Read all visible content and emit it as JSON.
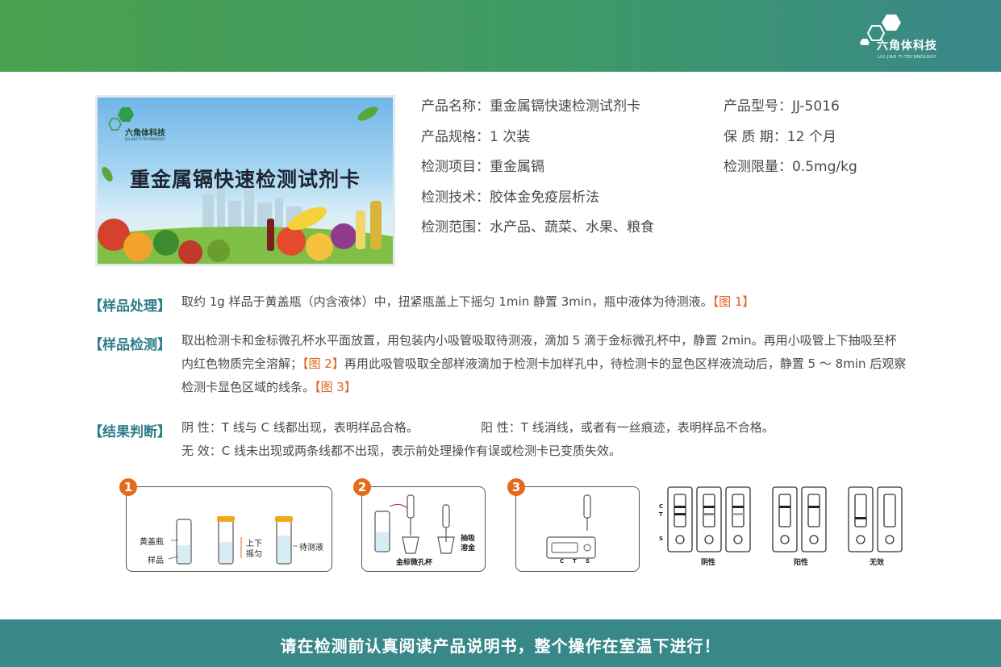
{
  "brand": {
    "name": "六角体科技",
    "subtitle": "LIU JIAO TI TECHNOLOGY",
    "primary_color": "#3f9a66",
    "accent_color": "#e56a1a"
  },
  "product_image": {
    "title": "重金属镉快速检测试剂卡",
    "logo_name": "六角体科技",
    "logo_subtitle": "LIU JIAO TI TECHNOLOGY"
  },
  "product_info": {
    "name": "产品名称：重金属镉快速检测试剂卡",
    "spec": "产品规格：1 次装",
    "item": "检测项目：重金属镉",
    "technique": "检测技术：胶体金免疫层析法",
    "scope": "检测范围：水产品、蔬菜、水果、粮食",
    "model": "产品型号：JJ-5016",
    "shelf_life": "保 质 期：12 个月",
    "limit": "检测限量：0.5mg/kg"
  },
  "sections": {
    "sample_processing": {
      "label": "【样品处理】",
      "text": "取约 1g 样品于黄盖瓶（内含液体）中，扭紧瓶盖上下摇匀 1min 静置 3min，瓶中液体为待测液。",
      "fig": "【图 1】"
    },
    "sample_detection": {
      "label": "【样品检测】",
      "text1": "取出检测卡和金标微孔杯水平面放置，用包装内小吸管吸取待测液，滴加 5 滴于金标微孔杯中，静置 2min。再用小吸管上下抽吸至杯内红色物质完全溶解；",
      "fig1": "【图 2】",
      "text2": "再用此吸管吸取全部样液滴加于检测卡加样孔中，待检测卡的显色区样液流动后，静置 5 ～ 8min 后观察检测卡显色区域的线条。",
      "fig2": "【图 3】"
    },
    "result": {
      "label": "【结果判断】",
      "negative": "阴 性：T 线与 C 线都出现，表明样品合格。",
      "positive": "阳 性：T 线消线，或者有一丝痕迹，表明样品不合格。",
      "invalid": "无 效：C 线未出现或两条线都不出现，表示前处理操作有误或检测卡已变质失效。"
    }
  },
  "diagrams": {
    "step1": {
      "number": "1",
      "bottle_label": "黄盖瓶",
      "sample_label": "样品",
      "shake_label_1": "上下",
      "shake_label_2": "摇匀",
      "liquid_label": "待测液"
    },
    "step2": {
      "number": "2",
      "cup_label": "金标微孔杯",
      "dissolve_label_1": "抽吸",
      "dissolve_label_2": "溶金"
    },
    "step3": {
      "number": "3",
      "card_marks": [
        "C",
        "T",
        "S"
      ]
    },
    "results": {
      "line_labels": [
        "C",
        "T",
        "S"
      ],
      "negative_label": "阴性",
      "positive_label": "阳性",
      "invalid_label": "无效"
    }
  },
  "footer": {
    "text": "请在检测前认真阅读产品说明书，整个操作在室温下进行！"
  }
}
